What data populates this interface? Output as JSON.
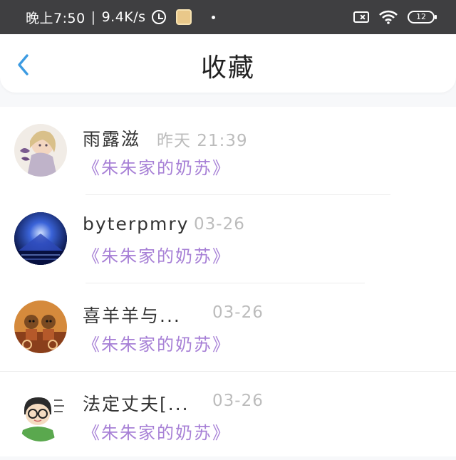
{
  "status_bar": {
    "time": "晚上7:50",
    "separator": "|",
    "speed": "9.4K/s",
    "battery": "12",
    "icons": [
      "alarm-icon",
      "app-notification-icon",
      "sim-icon",
      "wifi-icon",
      "battery-icon"
    ]
  },
  "header": {
    "title": "收藏",
    "back_icon": "chevron-left-icon"
  },
  "colors": {
    "accent_back": "#3c9be2",
    "collect_title": "#a780d6",
    "time_text": "#bcbcbc"
  },
  "items": [
    {
      "name": "雨露滋",
      "time": "昨天 21:39",
      "title": "《朱朱家的奶苏》"
    },
    {
      "name": "byterpmry",
      "time": "03-26",
      "title": "《朱朱家的奶苏》"
    },
    {
      "name": "喜羊羊与...",
      "time": "03-26",
      "title": "《朱朱家的奶苏》"
    },
    {
      "name": "法定丈夫[...",
      "time": "03-26",
      "title": "《朱朱家的奶苏》"
    }
  ]
}
